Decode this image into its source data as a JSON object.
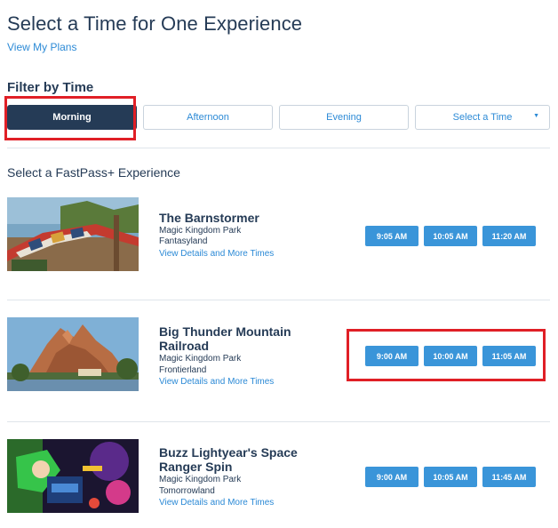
{
  "header": {
    "title": "Select a Time for One Experience",
    "view_plans": "View My Plans"
  },
  "filter": {
    "heading": "Filter by Time",
    "options": [
      "Morning",
      "Afternoon",
      "Evening"
    ],
    "selected": "Morning",
    "select_time": "Select a Time"
  },
  "section": {
    "heading": "Select a FastPass+ Experience"
  },
  "experiences": [
    {
      "name": "The Barnstormer",
      "park": "Magic Kingdom Park",
      "land": "Fantasyland",
      "link": "View Details and More Times",
      "times": [
        "9:05 AM",
        "10:05 AM",
        "11:20 AM"
      ]
    },
    {
      "name_line1": "Big Thunder Mountain",
      "name_line2": "Railroad",
      "park": "Magic Kingdom Park",
      "land": "Frontierland",
      "link": "View Details and More Times",
      "times": [
        "9:00 AM",
        "10:00 AM",
        "11:05 AM"
      ]
    },
    {
      "name_line1": "Buzz Lightyear's Space",
      "name_line2": "Ranger Spin",
      "park": "Magic Kingdom Park",
      "land": "Tomorrowland",
      "link": "View Details and More Times",
      "times": [
        "9:00 AM",
        "10:05 AM",
        "11:45 AM"
      ]
    }
  ],
  "colors": {
    "navy": "#253b56",
    "link_blue": "#2c8ad6",
    "time_button": "#3a95d9",
    "annotation_red": "#e01f26"
  }
}
